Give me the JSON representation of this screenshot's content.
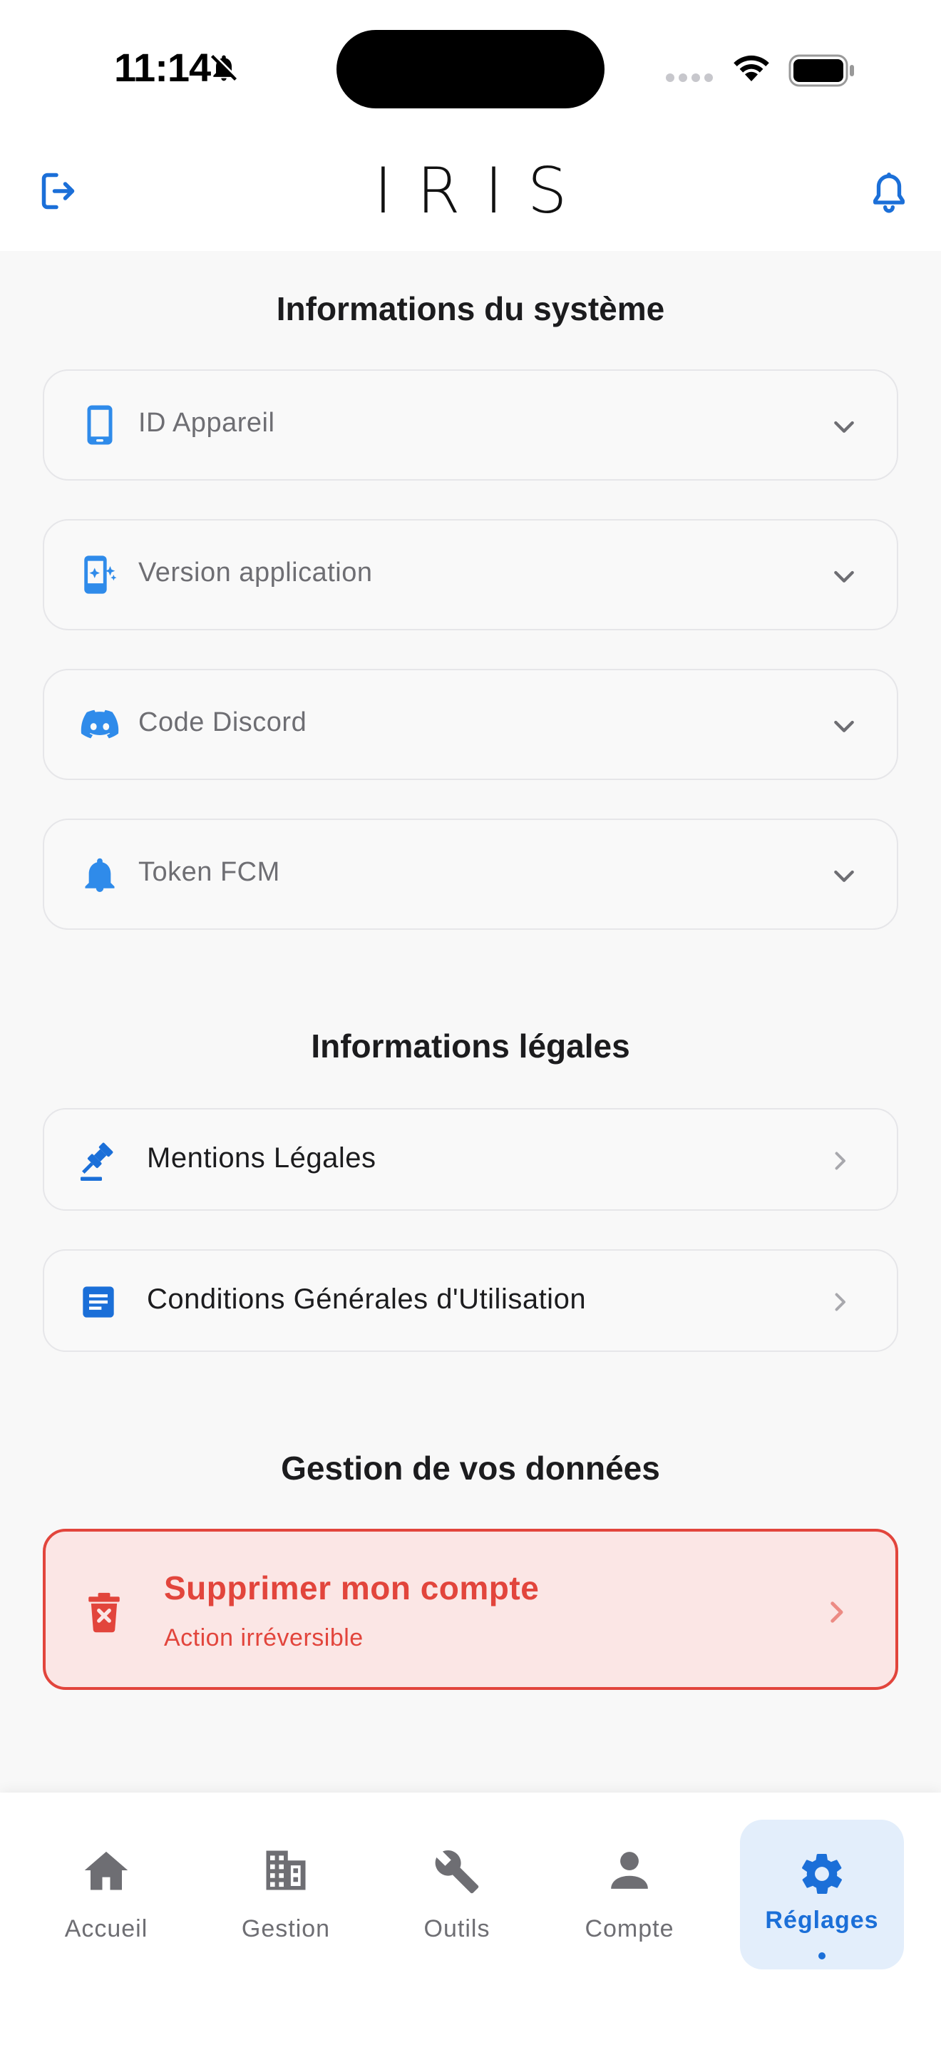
{
  "status_bar": {
    "time": "11:14"
  },
  "header": {
    "logo": "IRIS"
  },
  "system_section": {
    "title": "Informations du système",
    "items": [
      {
        "label": "ID Appareil",
        "icon": "smartphone-icon"
      },
      {
        "label": "Version application",
        "icon": "app-version-icon"
      },
      {
        "label": "Code Discord",
        "icon": "discord-icon"
      },
      {
        "label": "Token FCM",
        "icon": "bell-icon"
      }
    ]
  },
  "legal_section": {
    "title": "Informations légales",
    "items": [
      {
        "label": "Mentions Légales",
        "icon": "gavel-icon"
      },
      {
        "label": "Conditions Générales d'Utilisation",
        "icon": "document-icon"
      }
    ]
  },
  "data_section": {
    "title": "Gestion de vos données",
    "delete": {
      "title": "Supprimer mon compte",
      "subtitle": "Action irréversible"
    }
  },
  "nav": {
    "items": [
      {
        "label": "Accueil",
        "icon": "home-icon"
      },
      {
        "label": "Gestion",
        "icon": "building-icon"
      },
      {
        "label": "Outils",
        "icon": "wrench-icon"
      },
      {
        "label": "Compte",
        "icon": "person-icon"
      },
      {
        "label": "Réglages",
        "icon": "gear-icon",
        "active": true
      }
    ]
  },
  "colors": {
    "accent": "#1b6fd8",
    "danger": "#e2453c",
    "danger_bg": "#fbe6e5",
    "background": "#f8f8f8"
  }
}
